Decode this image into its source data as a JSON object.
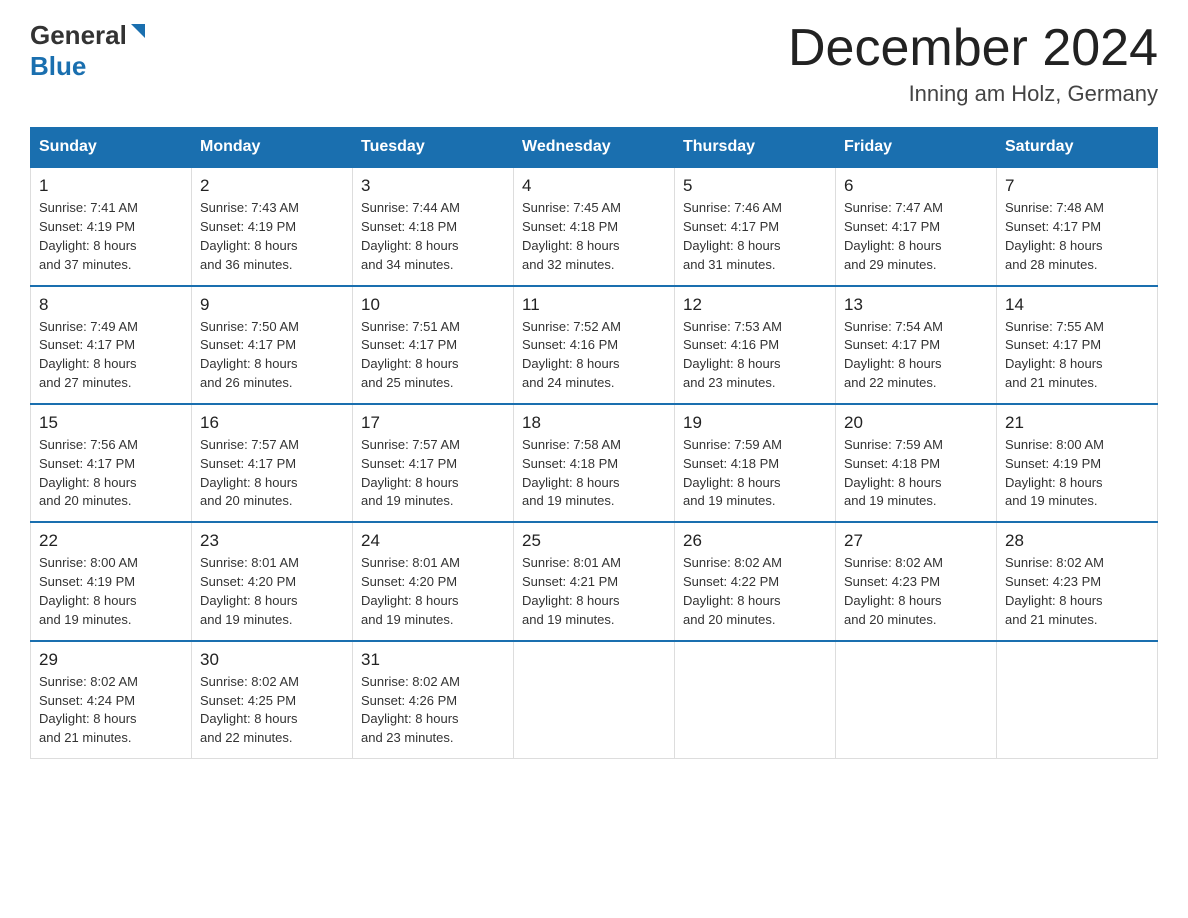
{
  "header": {
    "logo_general": "General",
    "logo_blue": "Blue",
    "month_title": "December 2024",
    "location": "Inning am Holz, Germany"
  },
  "columns": [
    "Sunday",
    "Monday",
    "Tuesday",
    "Wednesday",
    "Thursday",
    "Friday",
    "Saturday"
  ],
  "weeks": [
    [
      {
        "day": "1",
        "sunrise": "Sunrise: 7:41 AM",
        "sunset": "Sunset: 4:19 PM",
        "daylight": "Daylight: 8 hours",
        "daylight2": "and 37 minutes."
      },
      {
        "day": "2",
        "sunrise": "Sunrise: 7:43 AM",
        "sunset": "Sunset: 4:19 PM",
        "daylight": "Daylight: 8 hours",
        "daylight2": "and 36 minutes."
      },
      {
        "day": "3",
        "sunrise": "Sunrise: 7:44 AM",
        "sunset": "Sunset: 4:18 PM",
        "daylight": "Daylight: 8 hours",
        "daylight2": "and 34 minutes."
      },
      {
        "day": "4",
        "sunrise": "Sunrise: 7:45 AM",
        "sunset": "Sunset: 4:18 PM",
        "daylight": "Daylight: 8 hours",
        "daylight2": "and 32 minutes."
      },
      {
        "day": "5",
        "sunrise": "Sunrise: 7:46 AM",
        "sunset": "Sunset: 4:17 PM",
        "daylight": "Daylight: 8 hours",
        "daylight2": "and 31 minutes."
      },
      {
        "day": "6",
        "sunrise": "Sunrise: 7:47 AM",
        "sunset": "Sunset: 4:17 PM",
        "daylight": "Daylight: 8 hours",
        "daylight2": "and 29 minutes."
      },
      {
        "day": "7",
        "sunrise": "Sunrise: 7:48 AM",
        "sunset": "Sunset: 4:17 PM",
        "daylight": "Daylight: 8 hours",
        "daylight2": "and 28 minutes."
      }
    ],
    [
      {
        "day": "8",
        "sunrise": "Sunrise: 7:49 AM",
        "sunset": "Sunset: 4:17 PM",
        "daylight": "Daylight: 8 hours",
        "daylight2": "and 27 minutes."
      },
      {
        "day": "9",
        "sunrise": "Sunrise: 7:50 AM",
        "sunset": "Sunset: 4:17 PM",
        "daylight": "Daylight: 8 hours",
        "daylight2": "and 26 minutes."
      },
      {
        "day": "10",
        "sunrise": "Sunrise: 7:51 AM",
        "sunset": "Sunset: 4:17 PM",
        "daylight": "Daylight: 8 hours",
        "daylight2": "and 25 minutes."
      },
      {
        "day": "11",
        "sunrise": "Sunrise: 7:52 AM",
        "sunset": "Sunset: 4:16 PM",
        "daylight": "Daylight: 8 hours",
        "daylight2": "and 24 minutes."
      },
      {
        "day": "12",
        "sunrise": "Sunrise: 7:53 AM",
        "sunset": "Sunset: 4:16 PM",
        "daylight": "Daylight: 8 hours",
        "daylight2": "and 23 minutes."
      },
      {
        "day": "13",
        "sunrise": "Sunrise: 7:54 AM",
        "sunset": "Sunset: 4:17 PM",
        "daylight": "Daylight: 8 hours",
        "daylight2": "and 22 minutes."
      },
      {
        "day": "14",
        "sunrise": "Sunrise: 7:55 AM",
        "sunset": "Sunset: 4:17 PM",
        "daylight": "Daylight: 8 hours",
        "daylight2": "and 21 minutes."
      }
    ],
    [
      {
        "day": "15",
        "sunrise": "Sunrise: 7:56 AM",
        "sunset": "Sunset: 4:17 PM",
        "daylight": "Daylight: 8 hours",
        "daylight2": "and 20 minutes."
      },
      {
        "day": "16",
        "sunrise": "Sunrise: 7:57 AM",
        "sunset": "Sunset: 4:17 PM",
        "daylight": "Daylight: 8 hours",
        "daylight2": "and 20 minutes."
      },
      {
        "day": "17",
        "sunrise": "Sunrise: 7:57 AM",
        "sunset": "Sunset: 4:17 PM",
        "daylight": "Daylight: 8 hours",
        "daylight2": "and 19 minutes."
      },
      {
        "day": "18",
        "sunrise": "Sunrise: 7:58 AM",
        "sunset": "Sunset: 4:18 PM",
        "daylight": "Daylight: 8 hours",
        "daylight2": "and 19 minutes."
      },
      {
        "day": "19",
        "sunrise": "Sunrise: 7:59 AM",
        "sunset": "Sunset: 4:18 PM",
        "daylight": "Daylight: 8 hours",
        "daylight2": "and 19 minutes."
      },
      {
        "day": "20",
        "sunrise": "Sunrise: 7:59 AM",
        "sunset": "Sunset: 4:18 PM",
        "daylight": "Daylight: 8 hours",
        "daylight2": "and 19 minutes."
      },
      {
        "day": "21",
        "sunrise": "Sunrise: 8:00 AM",
        "sunset": "Sunset: 4:19 PM",
        "daylight": "Daylight: 8 hours",
        "daylight2": "and 19 minutes."
      }
    ],
    [
      {
        "day": "22",
        "sunrise": "Sunrise: 8:00 AM",
        "sunset": "Sunset: 4:19 PM",
        "daylight": "Daylight: 8 hours",
        "daylight2": "and 19 minutes."
      },
      {
        "day": "23",
        "sunrise": "Sunrise: 8:01 AM",
        "sunset": "Sunset: 4:20 PM",
        "daylight": "Daylight: 8 hours",
        "daylight2": "and 19 minutes."
      },
      {
        "day": "24",
        "sunrise": "Sunrise: 8:01 AM",
        "sunset": "Sunset: 4:20 PM",
        "daylight": "Daylight: 8 hours",
        "daylight2": "and 19 minutes."
      },
      {
        "day": "25",
        "sunrise": "Sunrise: 8:01 AM",
        "sunset": "Sunset: 4:21 PM",
        "daylight": "Daylight: 8 hours",
        "daylight2": "and 19 minutes."
      },
      {
        "day": "26",
        "sunrise": "Sunrise: 8:02 AM",
        "sunset": "Sunset: 4:22 PM",
        "daylight": "Daylight: 8 hours",
        "daylight2": "and 20 minutes."
      },
      {
        "day": "27",
        "sunrise": "Sunrise: 8:02 AM",
        "sunset": "Sunset: 4:23 PM",
        "daylight": "Daylight: 8 hours",
        "daylight2": "and 20 minutes."
      },
      {
        "day": "28",
        "sunrise": "Sunrise: 8:02 AM",
        "sunset": "Sunset: 4:23 PM",
        "daylight": "Daylight: 8 hours",
        "daylight2": "and 21 minutes."
      }
    ],
    [
      {
        "day": "29",
        "sunrise": "Sunrise: 8:02 AM",
        "sunset": "Sunset: 4:24 PM",
        "daylight": "Daylight: 8 hours",
        "daylight2": "and 21 minutes."
      },
      {
        "day": "30",
        "sunrise": "Sunrise: 8:02 AM",
        "sunset": "Sunset: 4:25 PM",
        "daylight": "Daylight: 8 hours",
        "daylight2": "and 22 minutes."
      },
      {
        "day": "31",
        "sunrise": "Sunrise: 8:02 AM",
        "sunset": "Sunset: 4:26 PM",
        "daylight": "Daylight: 8 hours",
        "daylight2": "and 23 minutes."
      },
      null,
      null,
      null,
      null
    ]
  ]
}
